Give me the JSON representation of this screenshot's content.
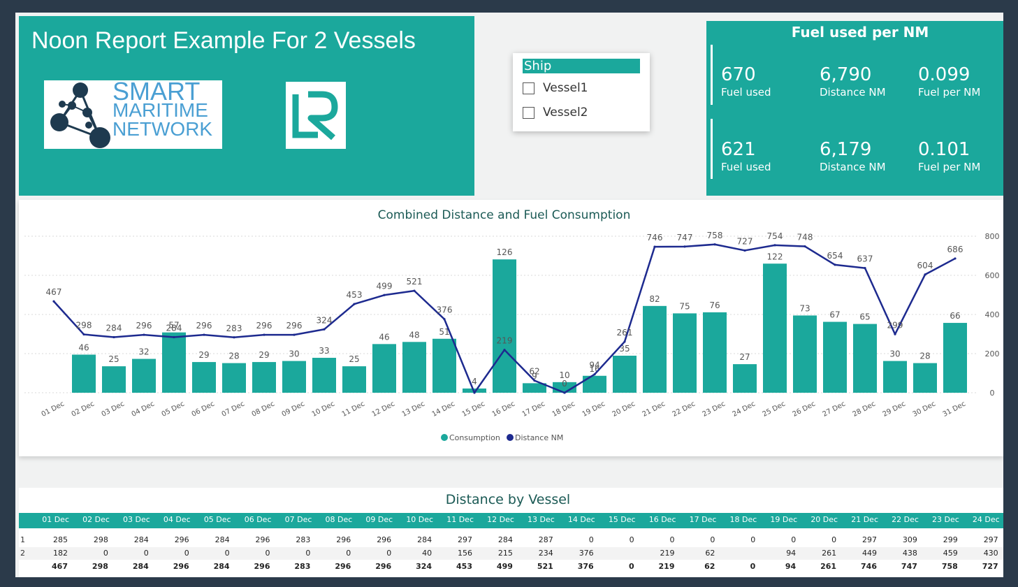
{
  "header": {
    "title": "Noon Report Example For 2 Vessels",
    "smn_logo": {
      "lines": [
        "SMART",
        "MARITIME",
        "NETWORK"
      ]
    },
    "lr_logo": {
      "text": "LR"
    }
  },
  "slicer": {
    "title": "Ship",
    "options": [
      {
        "label": "Vessel1",
        "checked": false
      },
      {
        "label": "Vessel2",
        "checked": false
      }
    ]
  },
  "kpi": {
    "title": "Fuel used per NM",
    "rows": [
      {
        "fuel_used": "670",
        "fuel_used_label": "Fuel used",
        "distance": "6,790",
        "distance_label": "Distance NM",
        "fuel_per_nm": "0.099",
        "fuel_per_nm_label": "Fuel per NM"
      },
      {
        "fuel_used": "621",
        "fuel_used_label": "Fuel used",
        "distance": "6,179",
        "distance_label": "Distance NM",
        "fuel_per_nm": "0.101",
        "fuel_per_nm_label": "Fuel per NM"
      }
    ]
  },
  "colors": {
    "teal": "#1ba89c",
    "navy": "#1d2a8f",
    "background": "#2b3a4a"
  },
  "chart_data": {
    "type": "bar",
    "title": "Combined Distance and Fuel Consumption",
    "categories": [
      "01 Dec",
      "02 Dec",
      "03 Dec",
      "04 Dec",
      "05 Dec",
      "06 Dec",
      "07 Dec",
      "08 Dec",
      "09 Dec",
      "10 Dec",
      "11 Dec",
      "12 Dec",
      "13 Dec",
      "14 Dec",
      "15 Dec",
      "16 Dec",
      "17 Dec",
      "18 Dec",
      "19 Dec",
      "20 Dec",
      "21 Dec",
      "22 Dec",
      "23 Dec",
      "24 Dec",
      "25 Dec",
      "26 Dec",
      "27 Dec",
      "28 Dec",
      "29 Dec",
      "30 Dec",
      "31 Dec"
    ],
    "series": [
      {
        "name": "Consumption",
        "type": "bar",
        "axis": "left",
        "color": "#1ba89c",
        "values": [
          null,
          36,
          25,
          32,
          57,
          29,
          28,
          29,
          30,
          33,
          25,
          46,
          48,
          51,
          4,
          126,
          9,
          10,
          16,
          35,
          82,
          75,
          76,
          27,
          122,
          73,
          67,
          65,
          30,
          28,
          66
        ]
      },
      {
        "name": "Distance NM",
        "type": "line",
        "axis": "right",
        "color": "#1d2a8f",
        "values": [
          467,
          298,
          284,
          296,
          284,
          296,
          283,
          296,
          296,
          324,
          453,
          499,
          521,
          376,
          0,
          219,
          62,
          0,
          94,
          261,
          746,
          747,
          758,
          727,
          754,
          748,
          654,
          637,
          299,
          604,
          686
        ]
      }
    ],
    "bar_labels": [
      "",
      "46",
      "25",
      "32",
      "57",
      "29",
      "28",
      "29",
      "30",
      "33",
      "25",
      "46",
      "48",
      "51",
      "4",
      "126",
      "9",
      "10",
      "16",
      "35",
      "82",
      "75",
      "76",
      "27",
      "122",
      "73",
      "67",
      "65",
      "30",
      "28",
      "66"
    ],
    "line_labels": [
      "467",
      "298",
      "284",
      "296",
      "284",
      "296",
      "283",
      "296",
      "296",
      "324",
      "453",
      "499",
      "521",
      "376",
      "",
      "219",
      "62",
      "0",
      "94",
      "261",
      "746",
      "747",
      "758",
      "727",
      "754",
      "748",
      "654",
      "637",
      "299",
      "604",
      "686"
    ],
    "y_right_ticks": [
      "0",
      "200",
      "400",
      "600",
      "800"
    ],
    "y_right_lim": [
      0,
      800
    ],
    "y_left_lim": [
      0,
      140
    ],
    "legend": {
      "position": "bottom-center",
      "items": [
        "Consumption",
        "Distance NM"
      ]
    },
    "grid": true
  },
  "table": {
    "title": "Distance by Vessel",
    "columns": [
      "01 Dec",
      "02 Dec",
      "03 Dec",
      "04 Dec",
      "05 Dec",
      "06 Dec",
      "07 Dec",
      "08 Dec",
      "09 Dec",
      "10 Dec",
      "11 Dec",
      "12 Dec",
      "13 Dec",
      "14 Dec",
      "15 Dec",
      "16 Dec",
      "17 Dec",
      "18 Dec",
      "19 Dec",
      "20 Dec",
      "21 Dec",
      "22 Dec",
      "23 Dec",
      "24 Dec"
    ],
    "rows": [
      {
        "label": "1",
        "values": [
          "285",
          "298",
          "284",
          "296",
          "284",
          "296",
          "283",
          "296",
          "296",
          "284",
          "297",
          "284",
          "287",
          "0",
          "0",
          "0",
          "0",
          "0",
          "0",
          "0",
          "297",
          "309",
          "299",
          "297"
        ]
      },
      {
        "label": "2",
        "values": [
          "182",
          "0",
          "0",
          "0",
          "0",
          "0",
          "0",
          "0",
          "0",
          "40",
          "156",
          "215",
          "234",
          "376",
          "",
          "219",
          "62",
          "",
          "94",
          "261",
          "449",
          "438",
          "459",
          "430"
        ]
      },
      {
        "label": "",
        "values": [
          "467",
          "298",
          "284",
          "296",
          "284",
          "296",
          "283",
          "296",
          "296",
          "324",
          "453",
          "499",
          "521",
          "376",
          "0",
          "219",
          "62",
          "0",
          "94",
          "261",
          "746",
          "747",
          "758",
          "727"
        ]
      }
    ]
  }
}
